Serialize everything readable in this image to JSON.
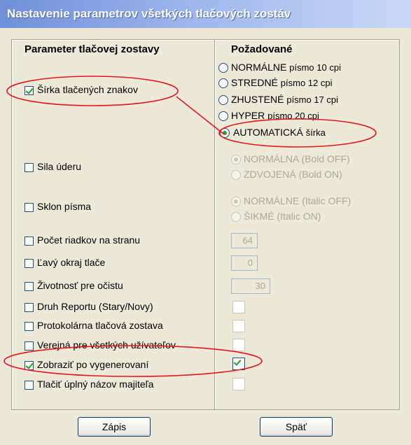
{
  "window": {
    "title": "Nastavenie parametrov všetkých tlačových zostáv"
  },
  "left": {
    "header": "Parameter tlačovej zostavy",
    "items": [
      {
        "label": "Šírka tlačených znakov",
        "checked": true
      },
      {
        "label": "Sila úderu",
        "checked": false
      },
      {
        "label": "Sklon písma",
        "checked": false
      },
      {
        "label": "Počet riadkov na stranu",
        "checked": false
      },
      {
        "label": "Ľavý okraj tlače",
        "checked": false
      },
      {
        "label": "Životnosť pre očistu",
        "checked": false
      },
      {
        "label": "Druh Reportu (Stary/Novy)",
        "checked": false
      },
      {
        "label": "Protokolárna tlačová zostava",
        "checked": false
      },
      {
        "label": "Verejná pre všetkých užívateľov",
        "checked": false
      },
      {
        "label": "Zobraziť po vygenerovaní",
        "checked": true
      },
      {
        "label": "Tlačiť úplný názov majiteľa",
        "checked": false
      }
    ]
  },
  "right": {
    "header": "Požadované",
    "width_options": [
      {
        "main": "NORMÁLNE",
        "sub": "písmo 10 cpi",
        "selected": false
      },
      {
        "main": "STREDNÉ",
        "sub": "písmo 12 cpi",
        "selected": false
      },
      {
        "main": "ZHUSTENÉ",
        "sub": "písmo 17 cpi",
        "selected": false
      },
      {
        "main": "HYPER",
        "sub": "písmo 20 cpi",
        "selected": false
      },
      {
        "main": "AUTOMATICKÁ",
        "sub": "šírka",
        "selected": true
      }
    ],
    "bold_options": [
      {
        "text": "NORMÁLNA (Bold OFF)",
        "selected": true
      },
      {
        "text": "ZDVOJENÁ (Bold ON)",
        "selected": false
      }
    ],
    "italic_options": [
      {
        "text": "NORMÁLNE (Italic OFF)",
        "selected": true
      },
      {
        "text": "ŠIKMÉ    (Italic ON)",
        "selected": false
      }
    ],
    "rows_per_page": "64",
    "left_margin": "0",
    "lifetime": "30",
    "report_type_checked": false,
    "protocol_checked": false,
    "public_checked": false,
    "show_after_checked": true,
    "full_owner_checked": false
  },
  "buttons": {
    "save": "Zápis",
    "back": "Späť"
  },
  "colors": {
    "title_start": "#6f8fd8",
    "dialog_bg": "#ece9d8",
    "annotation": "#e8141c",
    "check": "#21a121"
  }
}
